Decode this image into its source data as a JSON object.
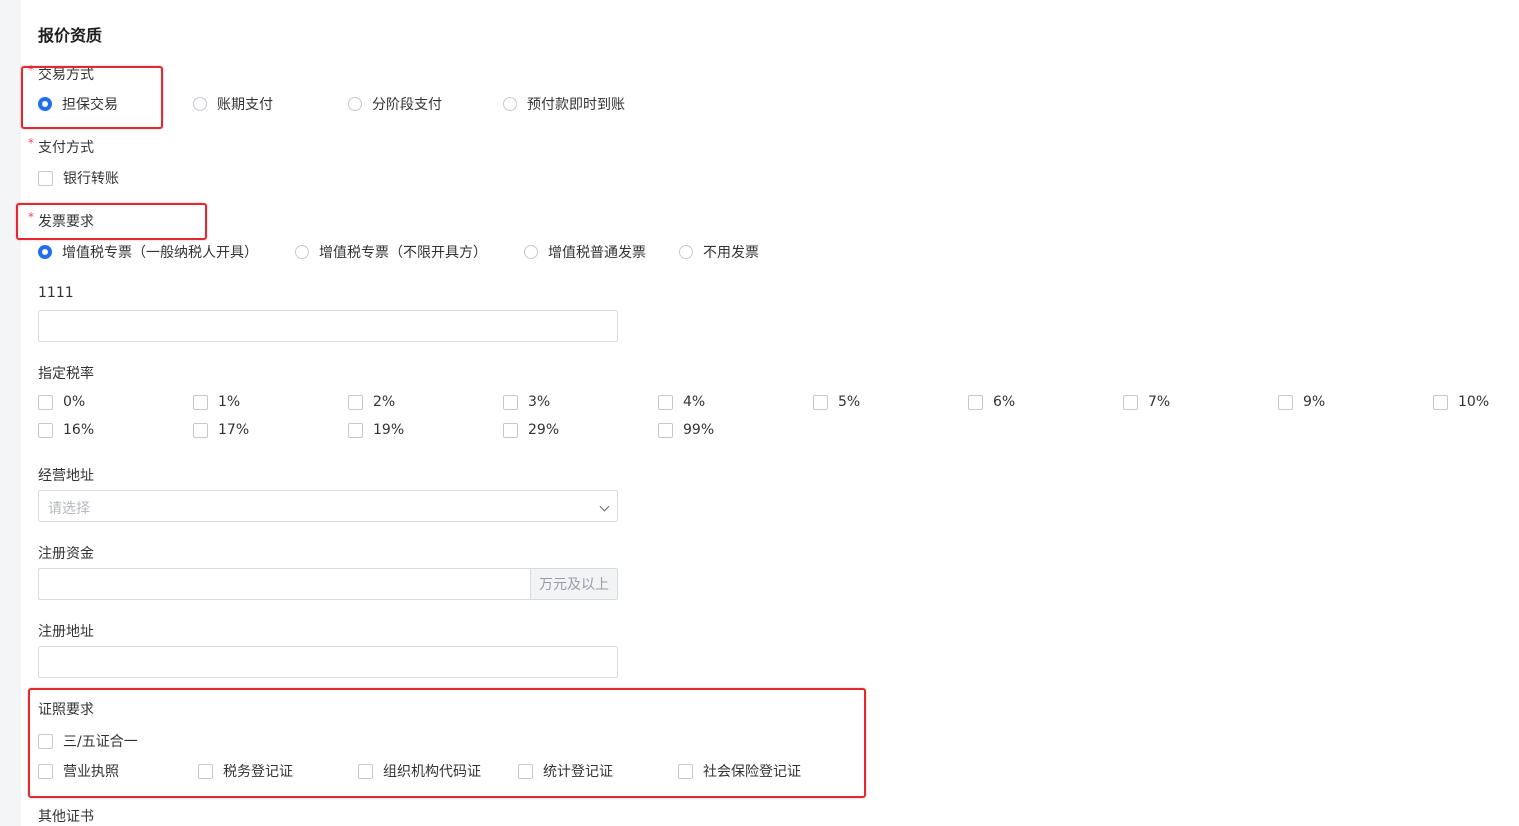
{
  "section_title": "报价资质",
  "required_mark": "*",
  "trade_method": {
    "label": "交易方式",
    "options": [
      "担保交易",
      "账期支付",
      "分阶段支付",
      "预付款即时到账"
    ],
    "selected": "担保交易"
  },
  "payment_method": {
    "label": "支付方式",
    "options": [
      "银行转账"
    ]
  },
  "invoice": {
    "label": "发票要求",
    "options": [
      "增值税专票（一般纳税人开具）",
      "增值税专票（不限开具方）",
      "增值税普通发票",
      "不用发票"
    ],
    "selected": "增值税专票（一般纳税人开具）"
  },
  "field_1111": {
    "label": "1111",
    "value": ""
  },
  "tax_rate": {
    "label": "指定税率",
    "row1": [
      "0%",
      "1%",
      "2%",
      "3%",
      "4%",
      "5%",
      "6%",
      "7%",
      "9%",
      "10%"
    ],
    "row2": [
      "16%",
      "17%",
      "19%",
      "29%",
      "99%"
    ]
  },
  "business_address": {
    "label": "经营地址",
    "placeholder": "请选择"
  },
  "registered_capital": {
    "label": "注册资金",
    "value": "",
    "suffix": "万元及以上"
  },
  "registered_address": {
    "label": "注册地址",
    "value": ""
  },
  "license": {
    "label": "证照要求",
    "row1": [
      "三/五证合一"
    ],
    "row2": [
      "营业执照",
      "税务登记证",
      "组织机构代码证",
      "统计登记证",
      "社会保险登记证"
    ]
  },
  "other_certificates": {
    "label": "其他证书"
  },
  "colors": {
    "primary": "#1f6ff0",
    "highlight_box": "#e8262e",
    "required": "#e34d59"
  }
}
